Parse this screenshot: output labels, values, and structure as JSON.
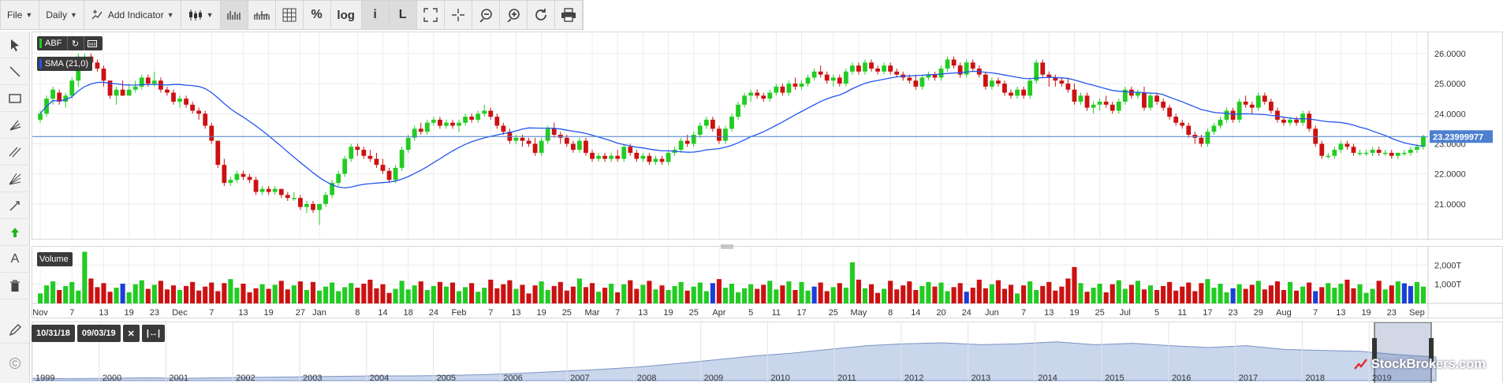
{
  "toolbar": {
    "file_label": "File",
    "period_label": "Daily",
    "add_indicator_label": "Add Indicator",
    "percent_label": "%",
    "log_label": "log",
    "info_label": "i",
    "L_label": "L"
  },
  "rail": {
    "text_tool_label": "A"
  },
  "main_chart": {
    "symbol_label": "ABF",
    "sma_label": "SMA (21,0)",
    "price_tag": "23.23999977",
    "volume_label": "Volume",
    "colors": {
      "up": "#22cc22",
      "down": "#cc1111",
      "neutral": "#1a3fd6",
      "sma": "#2255ee",
      "price_line": "#4d7fcf",
      "navigator_fill": "#c9d6ec"
    }
  },
  "navigator": {
    "start_date": "10/31/18",
    "end_date": "09/03/19",
    "reset_label": "✕",
    "expand_label": "|↔|",
    "years": [
      "1999",
      "2000",
      "2001",
      "2002",
      "2003",
      "2004",
      "2005",
      "2006",
      "2007",
      "2008",
      "2009",
      "2010",
      "2011",
      "2012",
      "2013",
      "2014",
      "2015",
      "2016",
      "2017",
      "2018",
      "2019"
    ]
  },
  "watermark": "StockBrokers.com",
  "chart_data": {
    "type": "candlestick",
    "title": "",
    "ylim": [
      20.0,
      26.6
    ],
    "yticks": [
      "26.0000",
      "25.0000",
      "24.0000",
      "23.0000",
      "22.0000",
      "21.0000"
    ],
    "ytick_values": [
      26,
      25,
      24,
      23,
      22,
      21
    ],
    "x_tick_labels": [
      "Nov",
      "7",
      "13",
      "19",
      "23",
      "Dec",
      "7",
      "13",
      "19",
      "27",
      "Jan",
      "8",
      "14",
      "18",
      "24",
      "Feb",
      "7",
      "13",
      "19",
      "25",
      "Mar",
      "7",
      "13",
      "19",
      "25",
      "Apr",
      "5",
      "11",
      "17",
      "25",
      "May",
      "8",
      "14",
      "20",
      "24",
      "Jun",
      "7",
      "13",
      "19",
      "25",
      "Jul",
      "5",
      "11",
      "17",
      "23",
      "29",
      "Aug",
      "7",
      "13",
      "19",
      "23",
      "Sep"
    ],
    "x_tick_index": [
      0,
      5,
      10,
      14,
      18,
      22,
      27,
      32,
      36,
      41,
      44,
      50,
      54,
      58,
      62,
      66,
      71,
      75,
      79,
      83,
      87,
      91,
      95,
      99,
      103,
      107,
      112,
      116,
      120,
      125,
      129,
      134,
      138,
      142,
      146,
      150,
      155,
      159,
      163,
      167,
      171,
      176,
      180,
      184,
      188,
      192,
      196,
      201,
      205,
      209,
      213,
      217
    ],
    "candles": [
      [
        23.8,
        24.1,
        23.7,
        24.0
      ],
      [
        24.0,
        24.6,
        23.9,
        24.5
      ],
      [
        24.5,
        24.9,
        24.3,
        24.8
      ],
      [
        24.7,
        24.8,
        24.3,
        24.4
      ],
      [
        24.4,
        24.7,
        24.2,
        24.6
      ],
      [
        24.6,
        25.2,
        24.5,
        25.1
      ],
      [
        25.1,
        26.0,
        24.9,
        25.9
      ],
      [
        25.9,
        26.0,
        25.6,
        25.9
      ],
      [
        25.9,
        26.0,
        25.7,
        25.7
      ],
      [
        25.7,
        25.8,
        25.4,
        25.5
      ],
      [
        25.5,
        25.6,
        24.9,
        25.1
      ],
      [
        25.1,
        25.1,
        24.5,
        24.6
      ],
      [
        24.6,
        24.9,
        24.3,
        24.8
      ],
      [
        24.8,
        25.1,
        24.6,
        24.6
      ],
      [
        24.6,
        25.0,
        24.6,
        24.8
      ],
      [
        24.8,
        25.1,
        24.7,
        24.9
      ],
      [
        24.9,
        25.3,
        24.8,
        25.2
      ],
      [
        25.2,
        25.3,
        24.9,
        25.0
      ],
      [
        25.0,
        25.4,
        24.9,
        25.1
      ],
      [
        25.1,
        25.2,
        24.7,
        24.8
      ],
      [
        24.8,
        24.9,
        24.6,
        24.7
      ],
      [
        24.7,
        24.8,
        24.3,
        24.4
      ],
      [
        24.4,
        24.6,
        24.2,
        24.5
      ],
      [
        24.5,
        24.6,
        24.2,
        24.3
      ],
      [
        24.3,
        24.4,
        24.0,
        24.1
      ],
      [
        24.1,
        24.2,
        23.8,
        24.0
      ],
      [
        24.0,
        24.1,
        23.5,
        23.6
      ],
      [
        23.6,
        23.7,
        23.0,
        23.1
      ],
      [
        23.1,
        23.1,
        22.2,
        22.3
      ],
      [
        22.3,
        22.5,
        21.6,
        21.7
      ],
      [
        21.7,
        21.9,
        21.6,
        21.8
      ],
      [
        21.8,
        22.1,
        21.7,
        22.0
      ],
      [
        22.0,
        22.1,
        21.8,
        21.9
      ],
      [
        21.9,
        22.0,
        21.7,
        21.8
      ],
      [
        21.8,
        21.9,
        21.3,
        21.4
      ],
      [
        21.4,
        21.6,
        21.3,
        21.5
      ],
      [
        21.5,
        21.6,
        21.3,
        21.4
      ],
      [
        21.4,
        21.6,
        21.3,
        21.5
      ],
      [
        21.5,
        21.5,
        21.2,
        21.3
      ],
      [
        21.3,
        21.4,
        21.1,
        21.2
      ],
      [
        21.2,
        21.4,
        21.1,
        21.2
      ],
      [
        21.2,
        21.3,
        20.8,
        20.9
      ],
      [
        20.9,
        21.1,
        20.7,
        21.0
      ],
      [
        21.0,
        21.1,
        20.7,
        20.8
      ],
      [
        20.8,
        21.0,
        20.3,
        21.0
      ],
      [
        21.0,
        21.4,
        20.9,
        21.3
      ],
      [
        21.3,
        21.8,
        21.2,
        21.7
      ],
      [
        21.7,
        22.1,
        21.6,
        22.0
      ],
      [
        22.0,
        22.6,
        21.9,
        22.5
      ],
      [
        22.5,
        23.0,
        22.4,
        22.9
      ],
      [
        22.9,
        23.0,
        22.6,
        22.8
      ],
      [
        22.8,
        22.9,
        22.5,
        22.6
      ],
      [
        22.6,
        22.8,
        22.4,
        22.5
      ],
      [
        22.5,
        22.7,
        22.2,
        22.3
      ],
      [
        22.3,
        22.5,
        22.0,
        22.1
      ],
      [
        22.1,
        22.2,
        21.7,
        21.8
      ],
      [
        21.8,
        22.3,
        21.7,
        22.2
      ],
      [
        22.2,
        22.9,
        22.1,
        22.8
      ],
      [
        22.8,
        23.3,
        22.7,
        23.2
      ],
      [
        23.2,
        23.6,
        23.1,
        23.5
      ],
      [
        23.5,
        23.7,
        23.3,
        23.4
      ],
      [
        23.4,
        23.8,
        23.3,
        23.7
      ],
      [
        23.7,
        23.9,
        23.6,
        23.8
      ],
      [
        23.8,
        23.9,
        23.5,
        23.6
      ],
      [
        23.6,
        23.8,
        23.5,
        23.7
      ],
      [
        23.7,
        23.8,
        23.5,
        23.6
      ],
      [
        23.6,
        23.8,
        23.4,
        23.7
      ],
      [
        23.7,
        24.0,
        23.6,
        23.9
      ],
      [
        23.9,
        24.0,
        23.7,
        23.8
      ],
      [
        23.8,
        24.1,
        23.7,
        24.0
      ],
      [
        24.0,
        24.3,
        23.9,
        24.1
      ],
      [
        24.1,
        24.2,
        23.8,
        23.9
      ],
      [
        23.9,
        24.0,
        23.5,
        23.6
      ],
      [
        23.6,
        23.7,
        23.3,
        23.4
      ],
      [
        23.4,
        23.5,
        23.0,
        23.1
      ],
      [
        23.1,
        23.3,
        23.0,
        23.2
      ],
      [
        23.2,
        23.3,
        22.9,
        23.1
      ],
      [
        23.1,
        23.2,
        22.9,
        23.0
      ],
      [
        23.0,
        23.2,
        22.6,
        22.7
      ],
      [
        22.7,
        23.2,
        22.6,
        23.1
      ],
      [
        23.1,
        23.6,
        23.0,
        23.5
      ],
      [
        23.5,
        23.7,
        23.2,
        23.3
      ],
      [
        23.3,
        23.4,
        23.0,
        23.2
      ],
      [
        23.2,
        23.3,
        22.9,
        23.0
      ],
      [
        23.0,
        23.1,
        22.7,
        22.8
      ],
      [
        22.8,
        23.2,
        22.7,
        23.1
      ],
      [
        23.1,
        23.2,
        22.6,
        22.7
      ],
      [
        22.7,
        22.8,
        22.4,
        22.5
      ],
      [
        22.5,
        22.7,
        22.4,
        22.6
      ],
      [
        22.6,
        22.7,
        22.4,
        22.5
      ],
      [
        22.5,
        22.7,
        22.4,
        22.6
      ],
      [
        22.6,
        22.8,
        22.4,
        22.5
      ],
      [
        22.5,
        23.0,
        22.4,
        22.9
      ],
      [
        22.9,
        23.0,
        22.6,
        22.7
      ],
      [
        22.7,
        22.8,
        22.4,
        22.5
      ],
      [
        22.5,
        22.7,
        22.4,
        22.6
      ],
      [
        22.6,
        22.7,
        22.3,
        22.4
      ],
      [
        22.4,
        22.6,
        22.3,
        22.5
      ],
      [
        22.5,
        22.6,
        22.3,
        22.4
      ],
      [
        22.4,
        22.8,
        22.3,
        22.7
      ],
      [
        22.7,
        22.9,
        22.6,
        22.8
      ],
      [
        22.8,
        23.2,
        22.7,
        23.1
      ],
      [
        23.1,
        23.3,
        22.9,
        23.0
      ],
      [
        23.0,
        23.4,
        22.9,
        23.3
      ],
      [
        23.3,
        23.7,
        23.2,
        23.6
      ],
      [
        23.6,
        23.9,
        23.5,
        23.8
      ],
      [
        23.8,
        23.9,
        23.4,
        23.5
      ],
      [
        23.5,
        23.6,
        23.0,
        23.1
      ],
      [
        23.1,
        23.6,
        23.0,
        23.5
      ],
      [
        23.5,
        24.0,
        23.4,
        23.9
      ],
      [
        23.9,
        24.4,
        23.8,
        24.3
      ],
      [
        24.3,
        24.7,
        24.2,
        24.6
      ],
      [
        24.6,
        24.8,
        24.4,
        24.7
      ],
      [
        24.7,
        24.8,
        24.5,
        24.6
      ],
      [
        24.6,
        24.7,
        24.4,
        24.5
      ],
      [
        24.5,
        24.8,
        24.4,
        24.7
      ],
      [
        24.7,
        25.0,
        24.6,
        24.9
      ],
      [
        24.9,
        25.0,
        24.6,
        24.7
      ],
      [
        24.7,
        25.1,
        24.6,
        25.0
      ],
      [
        25.0,
        25.2,
        24.8,
        24.9
      ],
      [
        24.9,
        25.1,
        24.8,
        25.0
      ],
      [
        25.0,
        25.3,
        24.9,
        25.2
      ],
      [
        25.2,
        25.5,
        25.1,
        25.4
      ],
      [
        25.4,
        25.6,
        25.2,
        25.3
      ],
      [
        25.3,
        25.4,
        25.0,
        25.1
      ],
      [
        25.1,
        25.3,
        24.9,
        25.2
      ],
      [
        25.2,
        25.3,
        24.9,
        25.0
      ],
      [
        25.0,
        25.5,
        24.9,
        25.4
      ],
      [
        25.4,
        25.7,
        25.3,
        25.6
      ],
      [
        25.6,
        25.7,
        25.3,
        25.4
      ],
      [
        25.4,
        25.8,
        25.3,
        25.7
      ],
      [
        25.7,
        25.8,
        25.4,
        25.5
      ],
      [
        25.5,
        25.6,
        25.3,
        25.4
      ],
      [
        25.4,
        25.7,
        25.3,
        25.6
      ],
      [
        25.6,
        25.7,
        25.3,
        25.4
      ],
      [
        25.4,
        25.5,
        25.2,
        25.3
      ],
      [
        25.3,
        25.4,
        25.1,
        25.2
      ],
      [
        25.2,
        25.3,
        25.0,
        25.1
      ],
      [
        25.1,
        25.3,
        24.8,
        24.9
      ],
      [
        24.9,
        25.3,
        24.8,
        25.2
      ],
      [
        25.2,
        25.4,
        25.1,
        25.3
      ],
      [
        25.3,
        25.4,
        25.1,
        25.2
      ],
      [
        25.2,
        25.6,
        25.1,
        25.5
      ],
      [
        25.5,
        25.9,
        25.4,
        25.8
      ],
      [
        25.8,
        25.9,
        25.5,
        25.6
      ],
      [
        25.6,
        25.7,
        25.2,
        25.3
      ],
      [
        25.3,
        25.8,
        25.2,
        25.7
      ],
      [
        25.7,
        25.8,
        25.4,
        25.5
      ],
      [
        25.5,
        25.6,
        25.2,
        25.3
      ],
      [
        25.3,
        25.4,
        24.8,
        24.9
      ],
      [
        24.9,
        25.2,
        24.8,
        25.1
      ],
      [
        25.1,
        25.2,
        24.9,
        25.0
      ],
      [
        25.0,
        25.1,
        24.6,
        24.7
      ],
      [
        24.7,
        24.8,
        24.5,
        24.6
      ],
      [
        24.6,
        24.9,
        24.5,
        24.8
      ],
      [
        24.8,
        24.9,
        24.5,
        24.6
      ],
      [
        24.6,
        25.2,
        24.5,
        25.1
      ],
      [
        25.1,
        25.8,
        25.0,
        25.7
      ],
      [
        25.7,
        25.8,
        25.2,
        25.3
      ],
      [
        25.3,
        25.4,
        24.9,
        25.2
      ],
      [
        25.2,
        25.3,
        24.9,
        25.1
      ],
      [
        25.1,
        25.2,
        24.9,
        25.0
      ],
      [
        25.0,
        25.2,
        24.7,
        24.8
      ],
      [
        24.8,
        25.0,
        24.3,
        24.4
      ],
      [
        24.4,
        24.7,
        24.3,
        24.6
      ],
      [
        24.6,
        24.7,
        24.1,
        24.2
      ],
      [
        24.2,
        24.4,
        24.0,
        24.3
      ],
      [
        24.3,
        24.5,
        24.1,
        24.4
      ],
      [
        24.4,
        24.6,
        24.2,
        24.3
      ],
      [
        24.3,
        24.4,
        24.0,
        24.1
      ],
      [
        24.1,
        24.5,
        24.0,
        24.4
      ],
      [
        24.4,
        24.9,
        24.3,
        24.8
      ],
      [
        24.8,
        24.9,
        24.5,
        24.6
      ],
      [
        24.6,
        24.8,
        24.5,
        24.7
      ],
      [
        24.7,
        24.9,
        24.1,
        24.2
      ],
      [
        24.2,
        24.7,
        24.1,
        24.6
      ],
      [
        24.6,
        24.7,
        24.3,
        24.4
      ],
      [
        24.4,
        24.5,
        24.1,
        24.2
      ],
      [
        24.2,
        24.3,
        23.8,
        23.9
      ],
      [
        23.9,
        24.0,
        23.6,
        23.7
      ],
      [
        23.7,
        23.8,
        23.5,
        23.6
      ],
      [
        23.6,
        23.7,
        23.2,
        23.3
      ],
      [
        23.3,
        23.4,
        23.0,
        23.2
      ],
      [
        23.2,
        23.3,
        22.9,
        23.0
      ],
      [
        23.0,
        23.5,
        22.9,
        23.4
      ],
      [
        23.4,
        23.7,
        23.3,
        23.6
      ],
      [
        23.6,
        23.9,
        23.5,
        23.8
      ],
      [
        23.8,
        24.2,
        23.7,
        24.1
      ],
      [
        24.1,
        24.2,
        23.7,
        23.8
      ],
      [
        23.8,
        24.5,
        23.7,
        24.4
      ],
      [
        24.4,
        24.6,
        24.2,
        24.3
      ],
      [
        24.3,
        24.4,
        24.0,
        24.2
      ],
      [
        24.2,
        24.7,
        24.1,
        24.6
      ],
      [
        24.6,
        24.7,
        24.3,
        24.4
      ],
      [
        24.4,
        24.5,
        24.0,
        24.1
      ],
      [
        24.1,
        24.2,
        23.7,
        23.8
      ],
      [
        23.8,
        23.9,
        23.6,
        23.7
      ],
      [
        23.7,
        23.9,
        23.6,
        23.8
      ],
      [
        23.8,
        23.9,
        23.6,
        23.7
      ],
      [
        23.7,
        24.1,
        23.6,
        24.0
      ],
      [
        24.0,
        24.1,
        23.4,
        23.5
      ],
      [
        23.5,
        23.6,
        22.9,
        23.0
      ],
      [
        23.0,
        23.1,
        22.5,
        22.6
      ],
      [
        22.6,
        22.7,
        22.5,
        22.6
      ],
      [
        22.6,
        22.9,
        22.5,
        22.8
      ],
      [
        22.8,
        23.1,
        22.7,
        23.0
      ],
      [
        23.0,
        23.1,
        22.8,
        22.9
      ],
      [
        22.9,
        23.0,
        22.6,
        22.7
      ],
      [
        22.7,
        22.8,
        22.6,
        22.7
      ],
      [
        22.7,
        22.8,
        22.6,
        22.7
      ],
      [
        22.7,
        22.9,
        22.6,
        22.8
      ],
      [
        22.8,
        22.9,
        22.6,
        22.7
      ],
      [
        22.7,
        22.8,
        22.6,
        22.7
      ],
      [
        22.7,
        22.8,
        22.5,
        22.6
      ],
      [
        22.6,
        22.7,
        22.5,
        22.7
      ],
      [
        22.7,
        22.8,
        22.6,
        22.7
      ],
      [
        22.7,
        22.9,
        22.6,
        22.8
      ],
      [
        22.8,
        23.0,
        22.7,
        22.9
      ],
      [
        22.9,
        23.3,
        22.8,
        23.24
      ]
    ],
    "sma_period": 21,
    "last_price": 23.23999977,
    "volume": {
      "ylim": [
        0,
        2800
      ],
      "yticks": [
        "2,000T",
        "1,000T"
      ],
      "ytick_values": [
        2000,
        1000
      ],
      "blue_indices": [
        13,
        106,
        122,
        146,
        188,
        201,
        215,
        216
      ],
      "spike_indices": {
        "7": 2700,
        "128": 2150,
        "163": 1900,
        "215": 1050
      }
    }
  }
}
